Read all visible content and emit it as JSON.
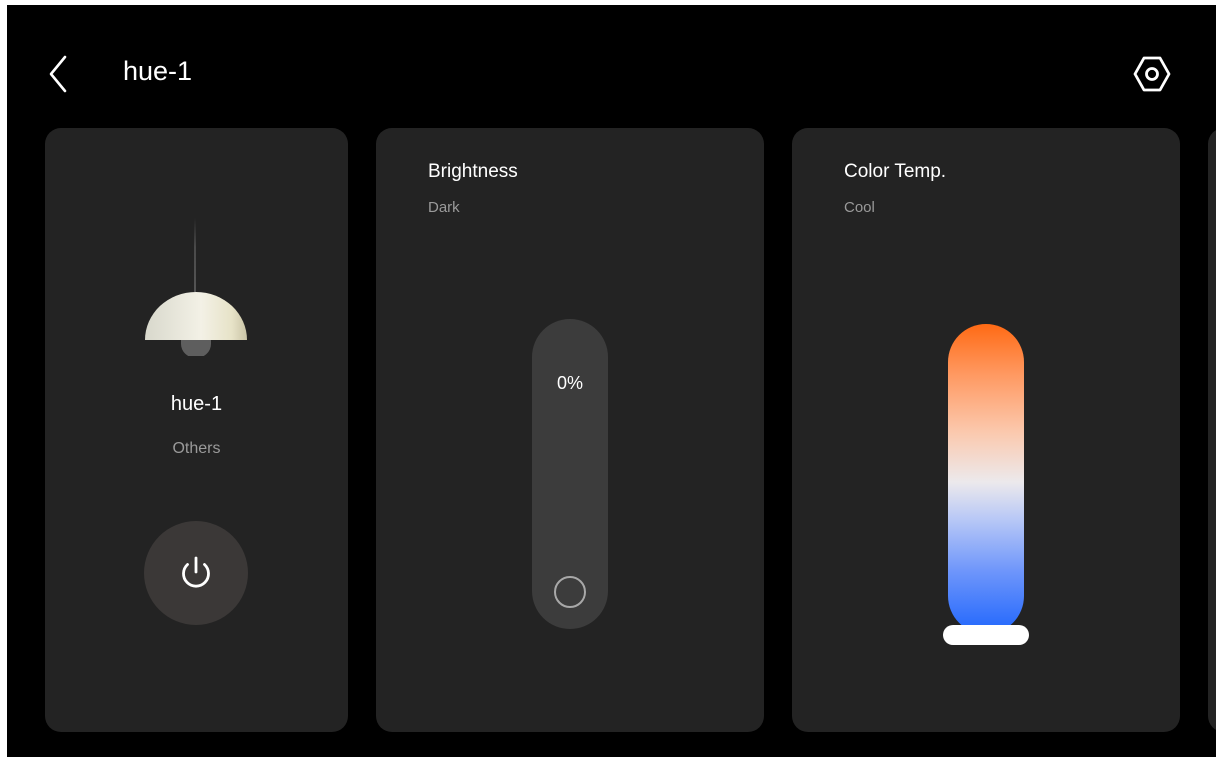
{
  "header": {
    "title": "hue-1",
    "back_icon": "back-chevron-icon",
    "settings_icon": "hexagon-settings-icon"
  },
  "device_card": {
    "name": "hue-1",
    "category": "Others",
    "lamp_icon": "pendant-lamp-icon",
    "power_icon": "power-icon"
  },
  "brightness_card": {
    "title": "Brightness",
    "subtitle": "Dark",
    "value_label": "0%",
    "level": 0
  },
  "color_temp_card": {
    "title": "Color Temp.",
    "subtitle": "Cool",
    "level": 0,
    "gradient_colors": [
      "#ff6a14",
      "#ece9ec",
      "#2066fc"
    ]
  },
  "colors": {
    "background": "#000000",
    "card": "#232323",
    "text_primary": "#ffffff",
    "text_secondary": "#9a9a9a"
  }
}
